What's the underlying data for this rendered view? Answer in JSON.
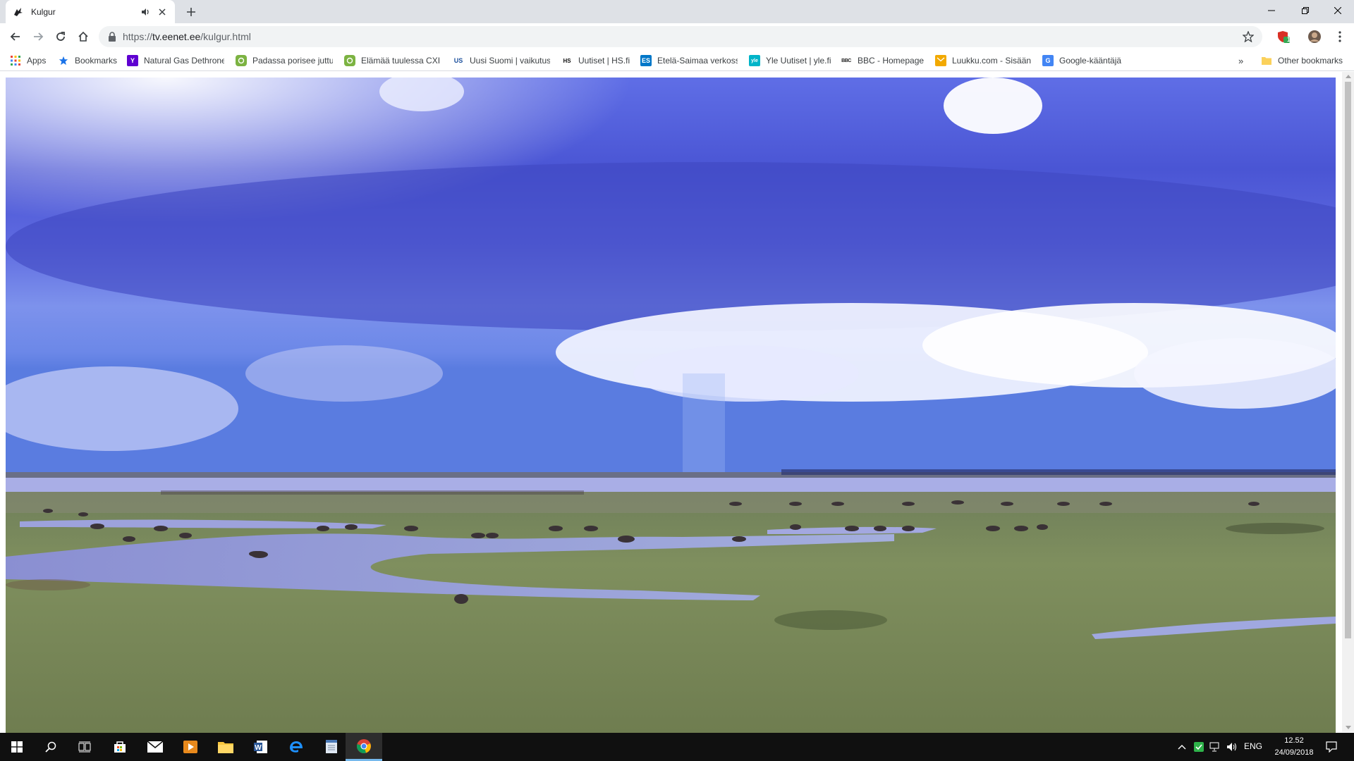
{
  "browser": {
    "tab": {
      "title": "Kulgur",
      "favicon": "bird-icon",
      "audio_icon": "speaker-icon",
      "close_icon": "close-icon"
    },
    "new_tab_icon": "plus-icon",
    "window_controls": [
      "minimize-icon",
      "restore-icon",
      "close-icon"
    ]
  },
  "toolbar": {
    "back_icon": "arrow-left-icon",
    "forward_icon": "arrow-right-icon",
    "reload_icon": "reload-icon",
    "home_icon": "home-icon",
    "url_scheme": "https://",
    "url_host": "tv.eenet.ee",
    "url_path": "/kulgur.html",
    "star_icon": "star-icon",
    "extension_badge": "1",
    "menu_icon": "kebab-menu-icon"
  },
  "bookmarks": {
    "items": [
      {
        "label": "Apps",
        "icon": "apps-grid-icon"
      },
      {
        "label": "Bookmarks",
        "icon": "star-icon"
      },
      {
        "label": "Natural Gas Dethrone",
        "icon": "yahoo-icon",
        "icon_text": "Y",
        "color": "#5f01d1"
      },
      {
        "label": "Padassa porisee juttu",
        "icon": "chat-icon",
        "color": "#7cb342"
      },
      {
        "label": "Elämää tuulessa CXIII",
        "icon": "chat-icon",
        "color": "#7cb342"
      },
      {
        "label": "Uusi Suomi | vaikutus",
        "icon": "us-icon",
        "icon_text": "US",
        "color": "#1b4f9c"
      },
      {
        "label": "Uutiset | HS.fi",
        "icon": "hs-icon",
        "icon_text": "HS",
        "color": "#111111"
      },
      {
        "label": "Etelä-Saimaa verkoss",
        "icon": "es-icon",
        "icon_text": "ES",
        "color": "#0077c8"
      },
      {
        "label": "Yle Uutiset | yle.fi",
        "icon": "yle-icon",
        "icon_text": "yle",
        "color": "#00b4c8"
      },
      {
        "label": "BBC - Homepage",
        "icon": "bbc-icon",
        "icon_text": "BBC",
        "color": "#222222"
      },
      {
        "label": "Luukku.com - Sisäänk",
        "icon": "mail-icon",
        "color": "#f2a900"
      },
      {
        "label": "Google-kääntäjä",
        "icon": "translate-icon",
        "color": "#4285f4"
      }
    ],
    "overflow_label": "»",
    "other_label": "Other bookmarks"
  },
  "content": {
    "video_description_icon": "live-stream-video"
  },
  "taskbar": {
    "items": [
      "windows-start-icon",
      "search-icon",
      "task-view-icon",
      "store-icon",
      "mail-icon",
      "media-player-icon",
      "file-explorer-icon",
      "word-icon",
      "edge-icon",
      "notepad-icon",
      "chrome-icon"
    ],
    "active": "chrome-icon",
    "tray": {
      "language": "ENG",
      "time": "12.52",
      "date": "24/09/2018"
    }
  }
}
